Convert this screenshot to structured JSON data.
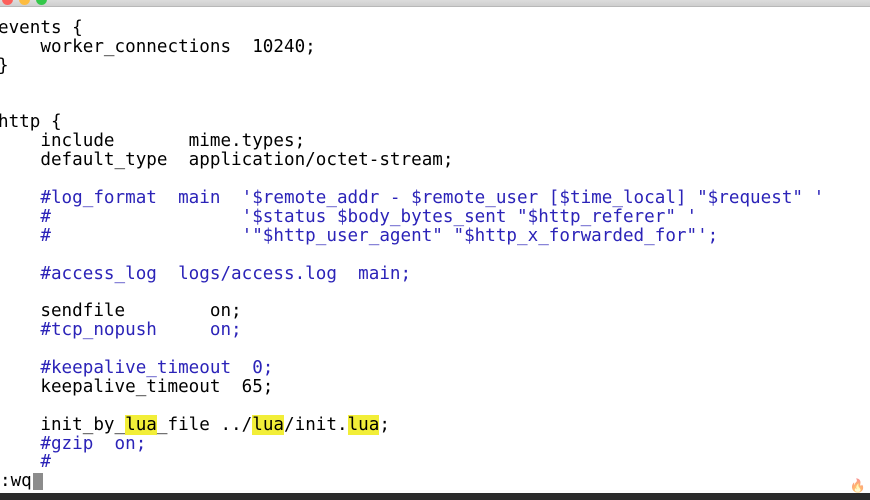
{
  "window": {
    "title": "",
    "colors": {
      "comment": "#2b23b8",
      "highlight": "#f2ee38",
      "text": "#000000",
      "background": "#ffffff"
    }
  },
  "editor": {
    "lines": [
      "events {",
      "    worker_connections  10240;",
      "}",
      "",
      "",
      "http {",
      "    include       mime.types;",
      "    default_type  application/octet-stream;",
      "",
      "    #log_format  main  '$remote_addr - $remote_user [$time_local] \"$request\" '",
      "    #                  '$status $body_bytes_sent \"$http_referer\" '",
      "    #                  '\"$http_user_agent\" \"$http_x_forwarded_for\"';",
      "",
      "    #access_log  logs/access.log  main;",
      "",
      "    sendfile        on;",
      "    #tcp_nopush     on;",
      "",
      "    #keepalive_timeout  0;",
      "    keepalive_timeout  65;",
      "",
      "    init_by_",
      "    #gzip  on;",
      "    #"
    ],
    "init_line": {
      "prefix": "    init_by_",
      "hl1": "lua",
      "mid1": "_file ../",
      "hl2": "lua",
      "mid2": "/init.",
      "hl3": "lua",
      "suffix": ";"
    }
  },
  "status": {
    "command": ":wq"
  },
  "watermark": {
    "icon": "flame-logo-icon"
  }
}
